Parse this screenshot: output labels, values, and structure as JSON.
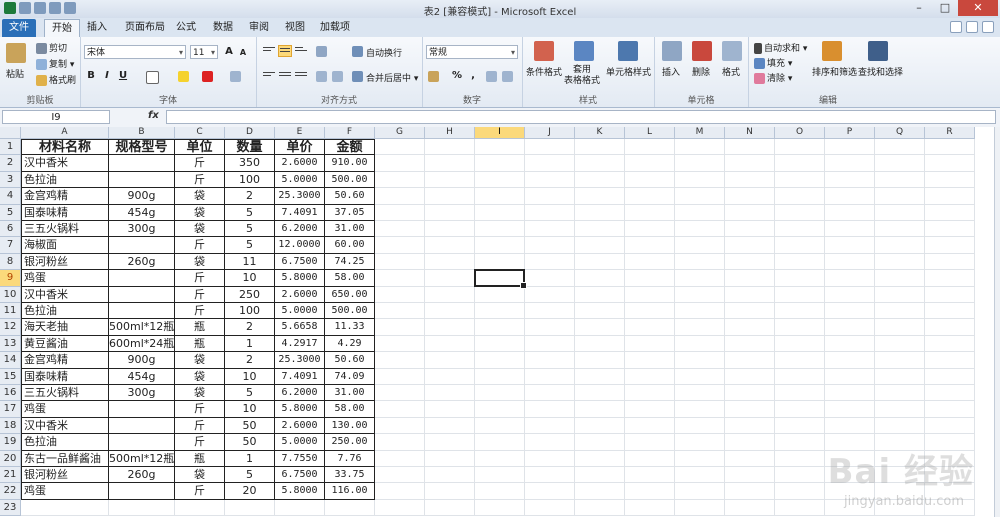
{
  "window": {
    "title": "表2  [兼容模式]  -  Microsoft Excel",
    "minimize": "–",
    "maximize": "□",
    "close": "✕"
  },
  "tabs": [
    "文件",
    "开始",
    "插入",
    "页面布局",
    "公式",
    "数据",
    "审阅",
    "视图",
    "加载项"
  ],
  "ribbon": {
    "clipboard": {
      "paste": "粘贴",
      "cut": "剪切",
      "copy": "复制 ▾",
      "format_painter": "格式刷",
      "label": "剪贴板"
    },
    "font": {
      "family": "宋体",
      "size": "11",
      "grow": "A",
      "shrink": "A",
      "bold": "B",
      "italic": "I",
      "underline": "U",
      "label": "字体"
    },
    "alignment": {
      "wrap": "自动换行",
      "merge": "合并后居中 ▾",
      "label": "对齐方式"
    },
    "number": {
      "format": "常规",
      "percent": "%",
      "comma": ",",
      "label": "数字"
    },
    "styles": {
      "conditional": "条件格式",
      "table": "套用\n表格格式",
      "cell": "单元格样式",
      "label": "样式"
    },
    "cells": {
      "insert": "插入",
      "delete": "删除",
      "format": "格式",
      "label": "单元格"
    },
    "editing": {
      "autosum": "自动求和 ▾",
      "fill": "填充 ▾",
      "clear": "清除 ▾",
      "sort": "排序和筛选",
      "find": "查找和选择",
      "label": "编辑"
    }
  },
  "formula_bar": {
    "name_box": "I9",
    "fx": "fx",
    "formula": ""
  },
  "columns": [
    "A",
    "B",
    "C",
    "D",
    "E",
    "F",
    "G",
    "H",
    "I",
    "J",
    "K",
    "L",
    "M",
    "N",
    "O",
    "P",
    "Q",
    "R"
  ],
  "selected_column": "I",
  "selected_row": 9,
  "headers": [
    "材料名称",
    "规格型号",
    "单位",
    "数量",
    "单价",
    "金额"
  ],
  "rows": [
    [
      "汉中香米",
      "",
      "斤",
      "350",
      "2.6000",
      "910.00"
    ],
    [
      "色拉油",
      "",
      "斤",
      "100",
      "5.0000",
      "500.00"
    ],
    [
      "金宫鸡精",
      "900g",
      "袋",
      "2",
      "25.3000",
      "50.60"
    ],
    [
      "国泰味精",
      "454g",
      "袋",
      "5",
      "7.4091",
      "37.05"
    ],
    [
      "三五火锅料",
      "300g",
      "袋",
      "5",
      "6.2000",
      "31.00"
    ],
    [
      "海椒面",
      "",
      "斤",
      "5",
      "12.0000",
      "60.00"
    ],
    [
      "银河粉丝",
      "260g",
      "袋",
      "11",
      "6.7500",
      "74.25"
    ],
    [
      "鸡蛋",
      "",
      "斤",
      "10",
      "5.8000",
      "58.00"
    ],
    [
      "汉中香米",
      "",
      "斤",
      "250",
      "2.6000",
      "650.00"
    ],
    [
      "色拉油",
      "",
      "斤",
      "100",
      "5.0000",
      "500.00"
    ],
    [
      "海天老抽",
      "500ml*12瓶",
      "瓶",
      "2",
      "5.6658",
      "11.33"
    ],
    [
      "黄豆酱油",
      "600ml*24瓶",
      "瓶",
      "1",
      "4.2917",
      "4.29"
    ],
    [
      "金宫鸡精",
      "900g",
      "袋",
      "2",
      "25.3000",
      "50.60"
    ],
    [
      "国泰味精",
      "454g",
      "袋",
      "10",
      "7.4091",
      "74.09"
    ],
    [
      "三五火锅料",
      "300g",
      "袋",
      "5",
      "6.2000",
      "31.00"
    ],
    [
      "鸡蛋",
      "",
      "斤",
      "10",
      "5.8000",
      "58.00"
    ],
    [
      "汉中香米",
      "",
      "斤",
      "50",
      "2.6000",
      "130.00"
    ],
    [
      "色拉油",
      "",
      "斤",
      "50",
      "5.0000",
      "250.00"
    ],
    [
      "东古一品鲜酱油",
      "500ml*12瓶",
      "瓶",
      "1",
      "7.7550",
      "7.76"
    ],
    [
      "银河粉丝",
      "260g",
      "袋",
      "5",
      "6.7500",
      "33.75"
    ],
    [
      "鸡蛋",
      "",
      "斤",
      "20",
      "5.8000",
      "116.00"
    ]
  ],
  "watermark": {
    "main": "Bai 经验",
    "sub": "jingyan.baidu.com"
  }
}
